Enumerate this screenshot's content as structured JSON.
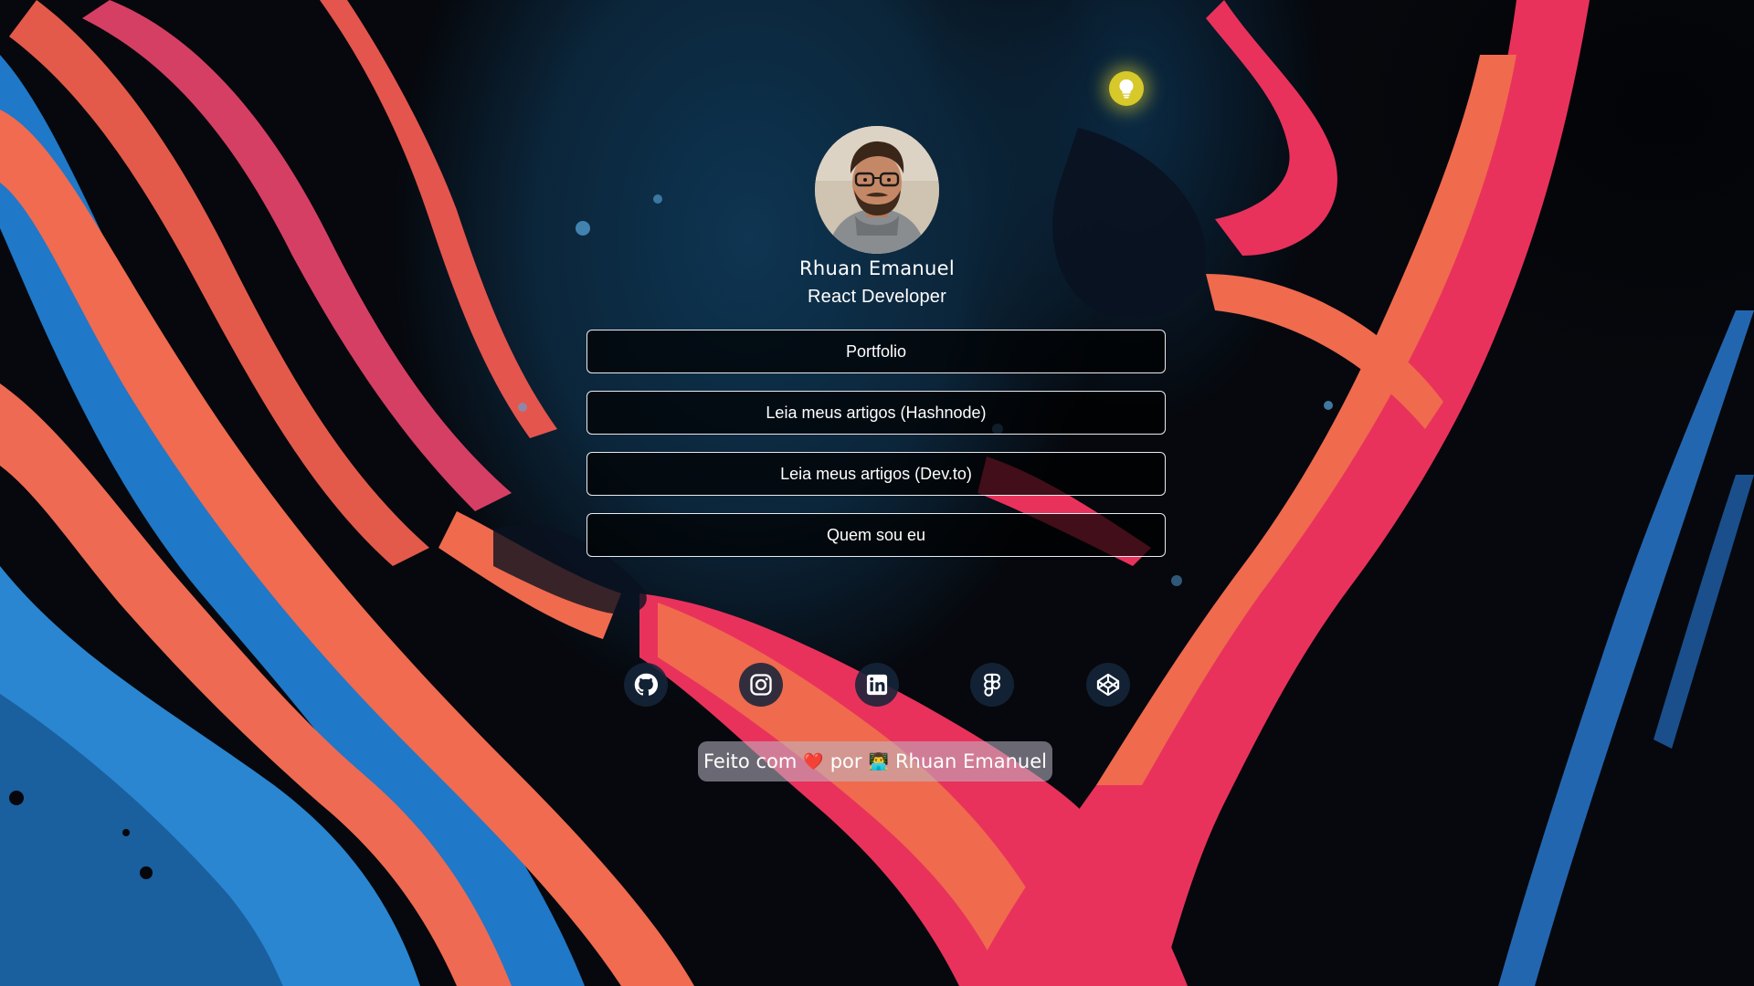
{
  "theme": {
    "accent_lamp": "#d7c92a",
    "button_border": "#e9ecf2",
    "text": "#ffffff"
  },
  "profile": {
    "name": "Rhuan Emanuel",
    "role": "React Developer"
  },
  "links": [
    {
      "label": "Portfolio"
    },
    {
      "label": "Leia meus artigos (Hashnode)"
    },
    {
      "label": "Leia meus artigos (Dev.to)"
    },
    {
      "label": "Quem sou eu"
    }
  ],
  "social": [
    {
      "icon": "github-icon"
    },
    {
      "icon": "instagram-icon"
    },
    {
      "icon": "linkedin-icon"
    },
    {
      "icon": "figma-icon"
    },
    {
      "icon": "codepen-icon"
    }
  ],
  "footer": {
    "prefix": "Feito com",
    "heart_emoji": "❤️",
    "middle": "por",
    "dev_emoji": "👨‍💻",
    "author": "Rhuan Emanuel"
  }
}
